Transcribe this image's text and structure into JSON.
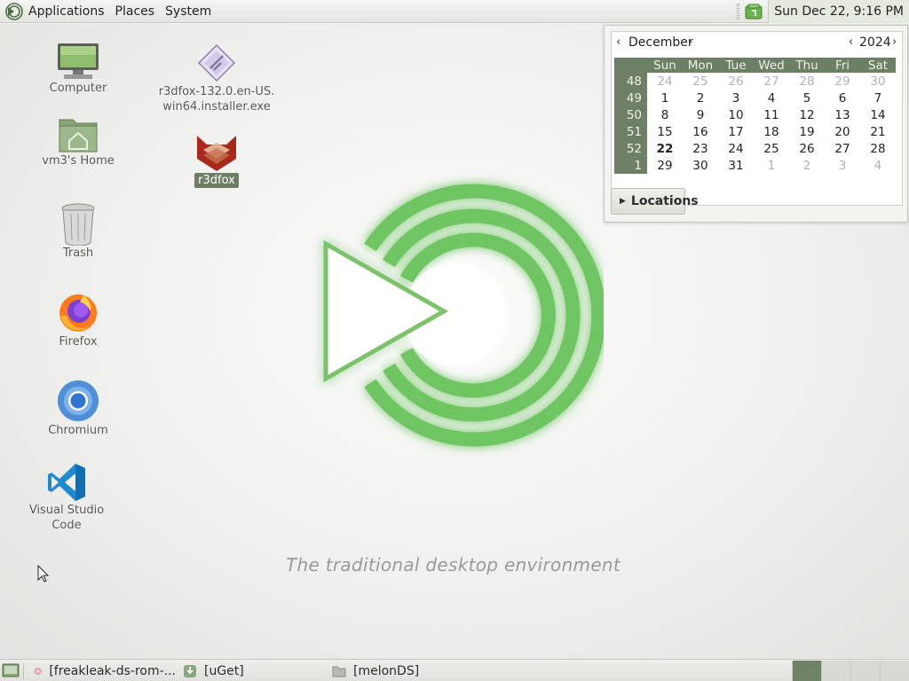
{
  "top_panel": {
    "menus": [
      "Applications",
      "Places",
      "System"
    ],
    "clock": "Sun Dec 22,  9:16 PM"
  },
  "desktop": {
    "icons": [
      {
        "label": "Computer",
        "icon": "computer-icon"
      },
      {
        "label": "vm3's Home",
        "icon": "home-folder-icon"
      },
      {
        "label": "Trash",
        "icon": "trash-icon"
      },
      {
        "label": "Firefox",
        "icon": "firefox-icon"
      },
      {
        "label": "Chromium",
        "icon": "chromium-icon"
      },
      {
        "label": "Visual Studio Code",
        "icon": "vscode-icon"
      },
      {
        "label": "r3dfox-132.0.en-US.\nwin64.installer.exe",
        "icon": "installer-file-icon"
      },
      {
        "label": "r3dfox",
        "icon": "r3dfox-icon"
      }
    ],
    "tagline": "The traditional desktop environment"
  },
  "calendar": {
    "month": "December",
    "year": "2024",
    "weekdays": [
      "Sun",
      "Mon",
      "Tue",
      "Wed",
      "Thu",
      "Fri",
      "Sat"
    ],
    "weeks": [
      {
        "num": "48",
        "days": [
          "24",
          "25",
          "26",
          "27",
          "28",
          "29",
          "30"
        ]
      },
      {
        "num": "49",
        "days": [
          "1",
          "2",
          "3",
          "4",
          "5",
          "6",
          "7"
        ]
      },
      {
        "num": "50",
        "days": [
          "8",
          "9",
          "10",
          "11",
          "12",
          "13",
          "14"
        ]
      },
      {
        "num": "51",
        "days": [
          "15",
          "16",
          "17",
          "18",
          "19",
          "20",
          "21"
        ]
      },
      {
        "num": "52",
        "days": [
          "22",
          "23",
          "24",
          "25",
          "26",
          "27",
          "28"
        ]
      },
      {
        "num": "1",
        "days": [
          "29",
          "30",
          "31",
          "1",
          "2",
          "3",
          "4"
        ]
      }
    ],
    "selected_day": "22",
    "locations_label": "Locations"
  },
  "taskbar": {
    "tasks": [
      {
        "label": "[freakleak-ds-rom-...",
        "icon": "app-icon"
      },
      {
        "label": "[uGet]",
        "icon": "uget-icon"
      },
      {
        "label": "[melonDS]",
        "icon": "folder-icon"
      }
    ],
    "workspaces": 4,
    "active_workspace": 1
  },
  "colors": {
    "accent": "#6d7f64",
    "mint_green": "#7cc26a",
    "tagline": "#9a9a9a"
  }
}
